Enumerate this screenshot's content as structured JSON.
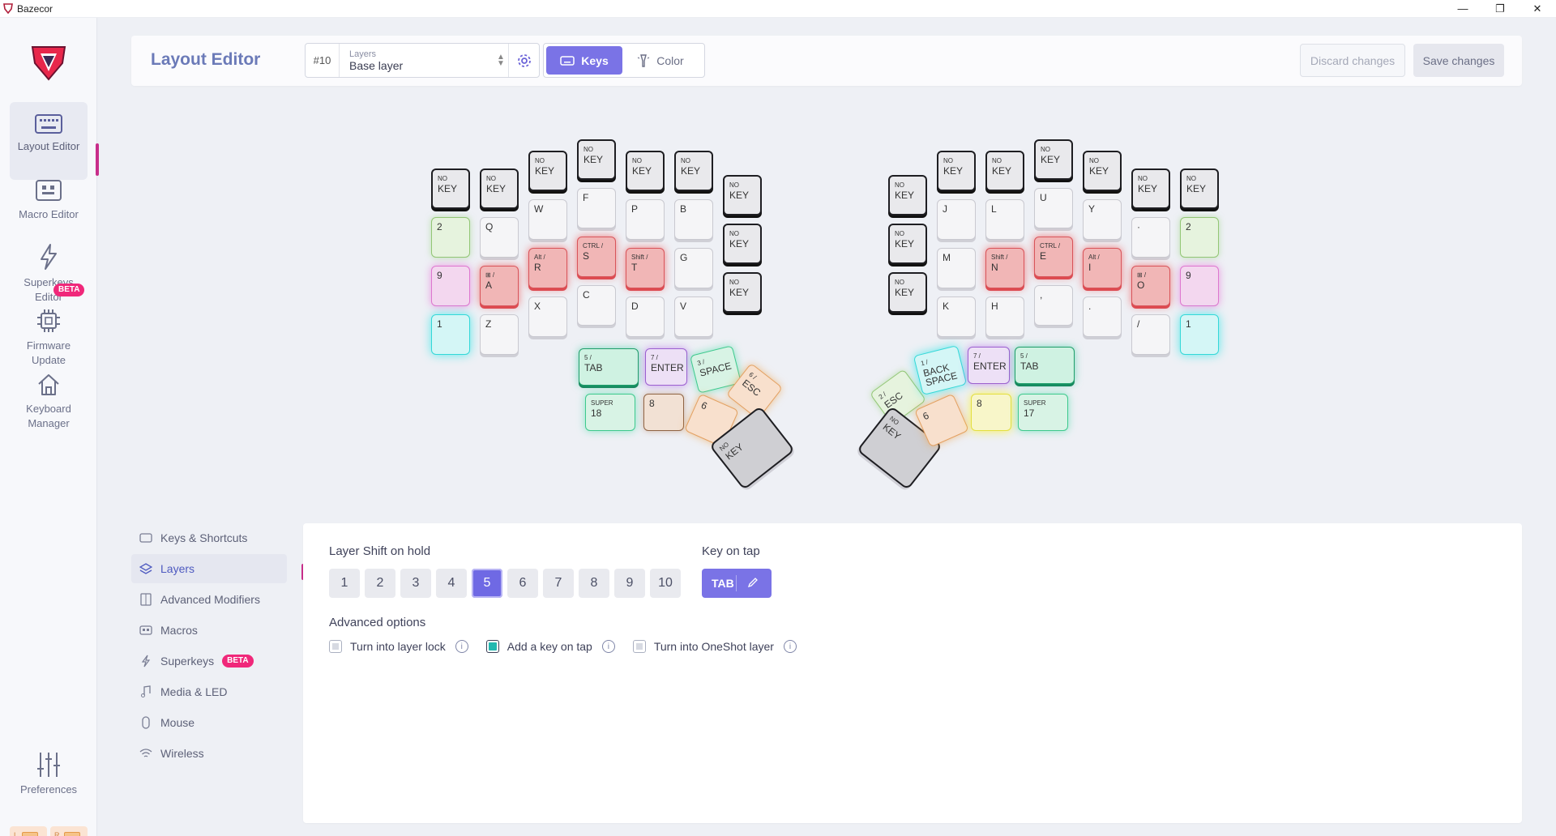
{
  "window": {
    "title": "Bazecor",
    "minimize": "—",
    "restore": "❐",
    "close": "✕"
  },
  "nav": {
    "items": [
      {
        "label": "Layout Editor",
        "icon": "keyboard-icon"
      },
      {
        "label": "Macro Editor",
        "icon": "macro-icon"
      },
      {
        "label": "Superkeys Editor",
        "icon": "lightning-icon",
        "badge": "BETA"
      },
      {
        "label": "Firmware Update",
        "icon": "chip-icon"
      },
      {
        "label": "Keyboard Manager",
        "icon": "home-icon"
      }
    ],
    "preferences": "Preferences",
    "battery_left": "L",
    "battery_right": "R"
  },
  "topbar": {
    "title": "Layout Editor",
    "layer_number": "#10",
    "layer_label": "Layers",
    "layer_value": "Base layer",
    "keys_tab": "Keys",
    "color_tab": "Color",
    "discard": "Discard changes",
    "save": "Save changes"
  },
  "keyboard": {
    "left": {
      "k1": {
        "s": "NO",
        "m": "KEY"
      },
      "k2": {
        "s": "NO",
        "m": "KEY"
      },
      "k3": {
        "s": "NO",
        "m": "KEY"
      },
      "k4": {
        "s": "NO",
        "m": "KEY"
      },
      "k5": {
        "s": "NO",
        "m": "KEY"
      },
      "k6": {
        "s": "NO",
        "m": "KEY"
      },
      "k7": {
        "s": "NO",
        "m": "KEY"
      },
      "q": "Q",
      "w": "W",
      "f": "F",
      "p": "P",
      "b": "B",
      "nk8": {
        "s": "NO",
        "m": "KEY"
      },
      "l2": "2",
      "a": {
        "s": "⊞ /",
        "m": "A"
      },
      "r": {
        "s": "Alt /",
        "m": "R"
      },
      "s": {
        "s": "CTRL /",
        "m": "S"
      },
      "t": {
        "s": "Shift /",
        "m": "T"
      },
      "g": "G",
      "nk9": {
        "s": "NO",
        "m": "KEY"
      },
      "l9": "9",
      "z": "Z",
      "x": "X",
      "c": "C",
      "d": "D",
      "v": "V",
      "l1": "1",
      "tab": {
        "s": "5 /",
        "m": "TAB"
      },
      "enter": {
        "s": "7 /",
        "m": "ENTER"
      },
      "space": {
        "s": "3 /",
        "m": "SPACE"
      },
      "esc": {
        "s": "6 /",
        "m": "ESC"
      },
      "super": {
        "s": "SUPER",
        "m": "18"
      },
      "l8": "8",
      "l6": "6",
      "nokey": {
        "s": "NO",
        "m": "KEY"
      }
    },
    "right": {
      "k1": {
        "s": "NO",
        "m": "KEY"
      },
      "k2": {
        "s": "NO",
        "m": "KEY"
      },
      "k3": {
        "s": "NO",
        "m": "KEY"
      },
      "k4": {
        "s": "NO",
        "m": "KEY"
      },
      "k5": {
        "s": "NO",
        "m": "KEY"
      },
      "k6": {
        "s": "NO",
        "m": "KEY"
      },
      "k7": {
        "s": "NO",
        "m": "KEY"
      },
      "j": "J",
      "l": "L",
      "u": "U",
      "y": "Y",
      "dot": "·",
      "l2": "2",
      "nk8": {
        "s": "NO",
        "m": "KEY"
      },
      "m": "M",
      "n": {
        "s": "Shift /",
        "m": "N"
      },
      "e": {
        "s": "CTRL /",
        "m": "E"
      },
      "i": {
        "s": "Alt /",
        "m": "I"
      },
      "o": {
        "s": "⊞ /",
        "m": "O"
      },
      "l9": "9",
      "nk9": {
        "s": "NO",
        "m": "KEY"
      },
      "k": "K",
      "h": "H",
      "comma": ",",
      "period": ".",
      "slash": "/",
      "l1": "1",
      "esc": {
        "s": "2 /",
        "m": "ESC"
      },
      "bs": {
        "s": "1 /",
        "m": "BACK SPACE"
      },
      "enter": {
        "s": "7 /",
        "m": "ENTER"
      },
      "tab": {
        "s": "5 /",
        "m": "TAB"
      },
      "nokey": {
        "s": "NO",
        "m": "KEY"
      },
      "l6": "6",
      "l8": "8",
      "super": {
        "s": "SUPER",
        "m": "17"
      }
    }
  },
  "menu": {
    "items": [
      {
        "label": "Keys & Shortcuts",
        "icon": "keyboard-icon"
      },
      {
        "label": "Layers",
        "icon": "layers-icon"
      },
      {
        "label": "Advanced Modifiers",
        "icon": "modifier-icon"
      },
      {
        "label": "Macros",
        "icon": "macro-icon"
      },
      {
        "label": "Superkeys",
        "icon": "lightning-icon",
        "badge": "BETA"
      },
      {
        "label": "Media & LED",
        "icon": "media-icon"
      },
      {
        "label": "Mouse",
        "icon": "mouse-icon"
      },
      {
        "label": "Wireless",
        "icon": "wifi-icon"
      }
    ]
  },
  "panel": {
    "layer_shift_title": "Layer Shift on hold",
    "layers": [
      "1",
      "2",
      "3",
      "4",
      "5",
      "6",
      "7",
      "8",
      "9",
      "10"
    ],
    "selected_layer": "5",
    "key_on_tap_title": "Key on tap",
    "key_on_tap_value": "TAB",
    "advanced_title": "Advanced options",
    "opt_lock": "Turn into layer lock",
    "opt_tap": "Add a key on tap",
    "opt_oneshot": "Turn into OneShot layer"
  },
  "colors": {
    "accent": "#7a73e6",
    "brand": "#c82e8a",
    "beta": "#f0287a"
  }
}
